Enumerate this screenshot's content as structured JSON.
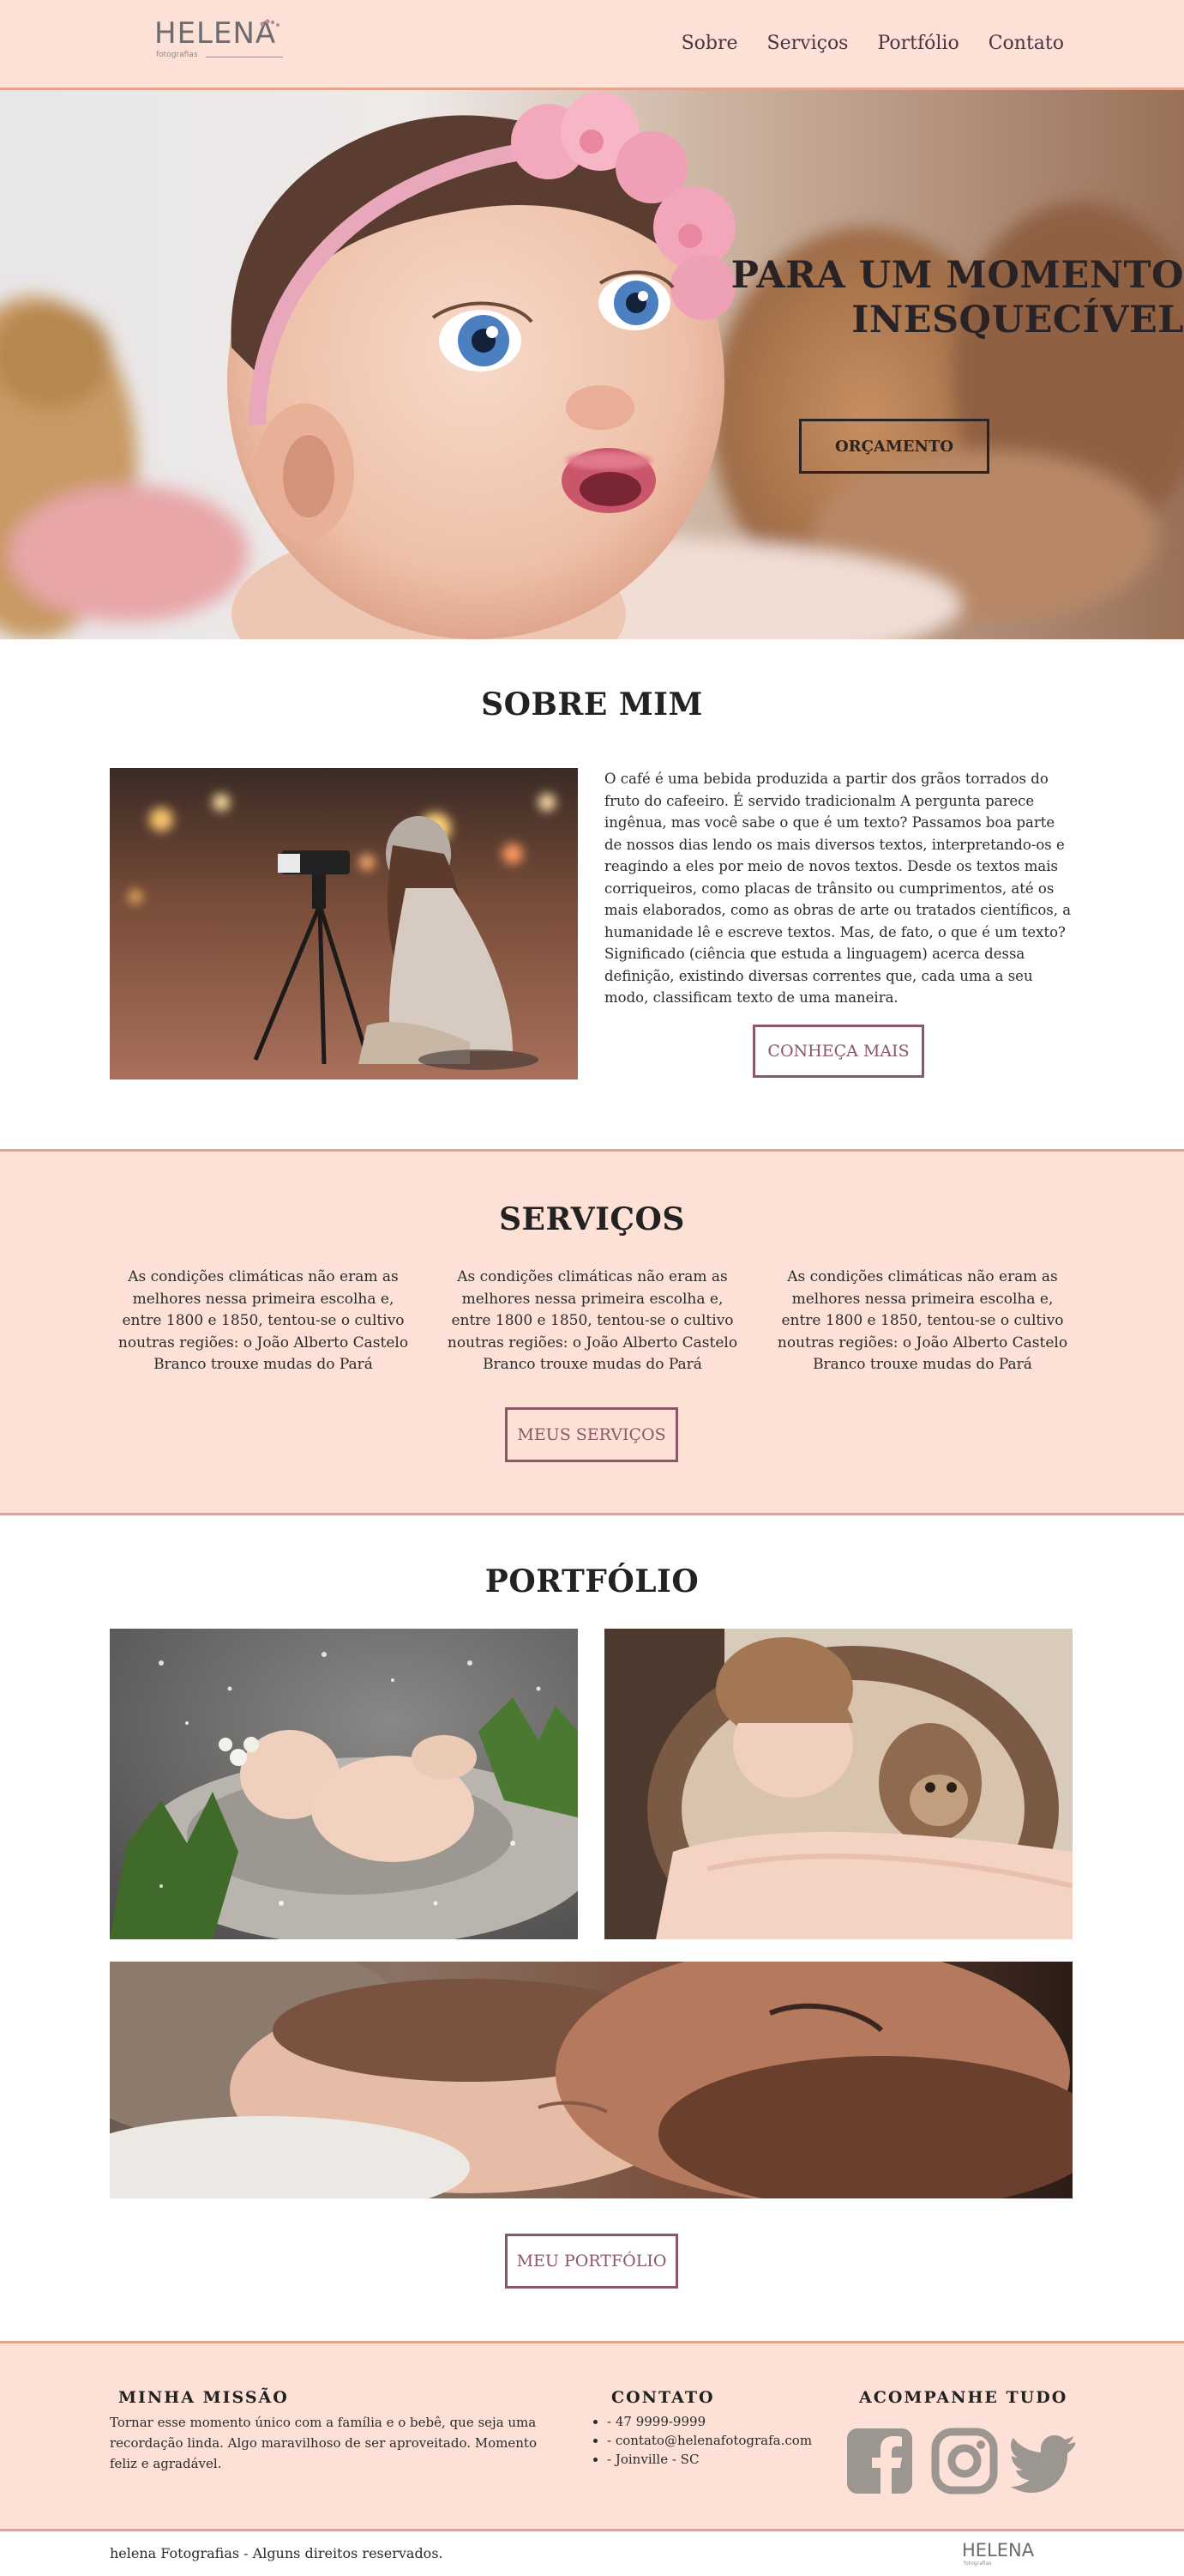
{
  "header": {
    "logo_word": "HELENA",
    "logo_sub": "fotografias",
    "nav": [
      "Sobre",
      "Serviços",
      "Portfólio",
      "Contato"
    ]
  },
  "hero": {
    "title_line1": "PARA UM MOMENTO",
    "title_line2": "INESQUECÍVEL",
    "button": "ORÇAMENTO"
  },
  "sobre": {
    "title": "SOBRE MIM",
    "text": "O café é uma bebida produzida a partir dos grãos torrados do fruto do cafeeiro. É servido tradicionalm A pergunta parece ingênua, mas você sabe o que é um texto? Passamos boa parte de nossos dias lendo os mais diversos textos, interpretando-os e reagindo a eles por meio de novos textos. Desde os textos mais corriqueiros, como placas de trânsito ou cumprimentos, até os mais elaborados, como as obras de arte ou tratados científicos, a humanidade lê e escreve textos. Mas, de fato, o que é um texto? Significado (ciência que estuda a linguagem) acerca dessa definição, existindo diversas correntes que, cada uma a seu modo, classificam texto de uma maneira.",
    "button": "CONHEÇA MAIS"
  },
  "servicos": {
    "title": "SERVIÇOS",
    "columns": [
      "As condições climáticas não eram as melhores nessa primeira escolha e, entre 1800 e 1850, tentou-se o cultivo noutras regiões: o João Alberto Castelo Branco trouxe mudas do Pará",
      "As condições climáticas não eram as melhores nessa primeira escolha e, entre 1800 e 1850, tentou-se o cultivo noutras regiões: o João Alberto Castelo Branco trouxe mudas do Pará",
      "As condições climáticas não eram as melhores nessa primeira escolha e, entre 1800 e 1850, tentou-se o cultivo noutras regiões: o João Alberto Castelo Branco trouxe mudas do Pará"
    ],
    "button": "MEUS SERVIÇOS"
  },
  "portfolio": {
    "title": "PORTFÓLIO",
    "button": "MEU PORTFÓLIO"
  },
  "footer": {
    "missao_title": "MINHA MISSÃO",
    "missao_text": "Tornar esse momento único com a família e o bebê, que seja uma recordação linda. Algo maravilhoso de ser aproveitado. Momento feliz e agradável.",
    "contato_title": "CONTATO",
    "contato_items": [
      "- 47 9999-9999",
      "- contato@helenafotografa.com",
      "- Joinville - SC"
    ],
    "social_title": "ACOMPANHE TUDO",
    "social_icons": [
      "facebook-icon",
      "instagram-icon",
      "twitter-icon"
    ],
    "copyright": "helena Fotografias - Alguns direitos reservados."
  },
  "colors": {
    "peach": "#fde0d6",
    "peach_border": "#e4a48e",
    "mauve": "#8a5866",
    "icon_gray": "#9c9690"
  }
}
